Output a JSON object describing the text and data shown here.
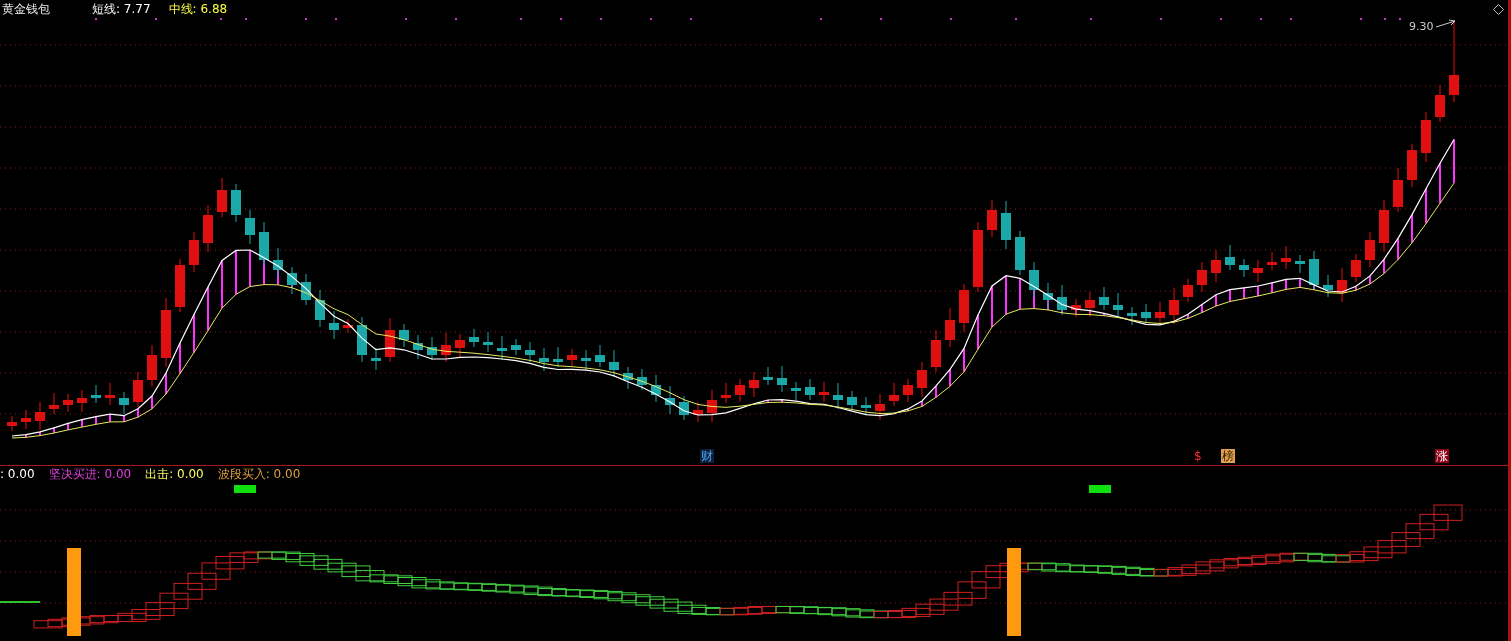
{
  "title": "黄金钱包",
  "legend": [
    {
      "text": "短线: 7.77",
      "kind": "short"
    },
    {
      "text": "中线: 6.88",
      "kind": "mid"
    }
  ],
  "price_annotation": "9.30",
  "event_markers": [
    {
      "text": "财",
      "kind": "finance"
    },
    {
      "text": "$",
      "kind": "dollar"
    },
    {
      "text": "榜",
      "kind": "list"
    },
    {
      "text": "涨",
      "kind": "limit"
    }
  ],
  "indicator": {
    "legend": [
      {
        "text": ": 0.00",
        "kind": "plain"
      },
      {
        "text": "坚决买进: 0.00",
        "kind": "buy"
      },
      {
        "text": "出击: 0.00",
        "kind": "attack"
      },
      {
        "text": "波段买入: 0.00",
        "kind": "swing"
      }
    ]
  }
}
